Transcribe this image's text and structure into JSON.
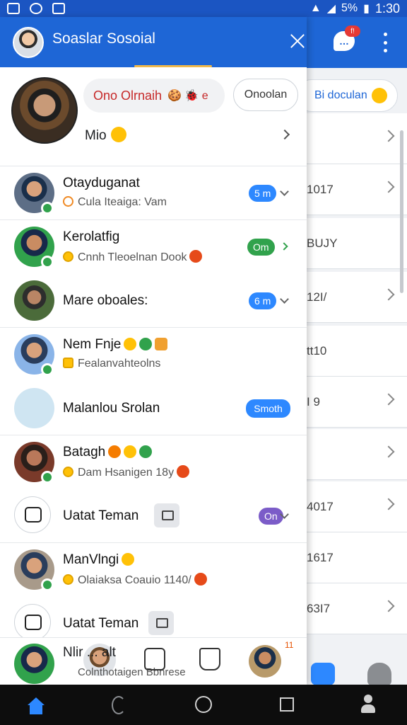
{
  "status_bar": {
    "battery": "5%",
    "time": "1:30"
  },
  "background": {
    "chat_badge": "f!",
    "pill_label": "Bi doculan",
    "rows": [
      "",
      "1017",
      "BUJY",
      "12I/",
      "tt10",
      "I 9",
      "",
      "4017",
      "1617",
      "63I7"
    ]
  },
  "drawer": {
    "title": "Soaslar Sosoial",
    "profile": {
      "status_text": "Ono Olrnaih",
      "status_emoji": "🍪 🐞 e",
      "open_button": "Onoolan",
      "name": "Mio"
    },
    "rows": [
      {
        "name": "Otayduganat",
        "sub": "Cula Iteaiga: Vam",
        "badge": "5 m",
        "badge_color": "#2d88ff",
        "control": "dropdown",
        "online": true,
        "sub_icon": "ring"
      },
      {
        "name": "Kerolatfig",
        "sub": "Cnnh Tleoelnan Dook",
        "badge": "Om",
        "badge_color": "#31a24c",
        "control": "arrow",
        "online": true,
        "sub_icon": "yellow"
      },
      {
        "name": "Mare oboales:",
        "sub": "",
        "badge": "6 m",
        "badge_color": "#2d88ff",
        "control": "dropdown",
        "online": false,
        "sub_icon": ""
      },
      {
        "name": "Nem Fnje",
        "sub": "Fealanvahteolns",
        "badge": "",
        "badge_color": "",
        "control": "",
        "online": true,
        "sub_icon": "square"
      },
      {
        "name": "Malanlou Srolan",
        "sub": "",
        "badge": "Smoth",
        "badge_color": "#2d88ff",
        "control": "",
        "online": false,
        "sub_icon": ""
      },
      {
        "name": "Batagh",
        "sub": "Dam Hsanigen 18y",
        "badge": "",
        "badge_color": "",
        "control": "",
        "online": true,
        "sub_icon": "yellow"
      },
      {
        "name": "Uatat Teman",
        "sub": "",
        "badge": "On",
        "badge_color": "#7b5cc8",
        "control": "dropdown",
        "online": false,
        "sub_icon": ""
      },
      {
        "name": "ManVlngi",
        "sub": "Olaiaksa Coauio 1140/",
        "badge": "",
        "badge_color": "",
        "control": "",
        "online": true,
        "sub_icon": "yellow"
      },
      {
        "name": "Uatat Teman",
        "sub": "",
        "badge": "",
        "badge_color": "",
        "control": "",
        "online": false,
        "sub_icon": ""
      }
    ],
    "bottom": {
      "name": "Nlir ... alt",
      "sub": "Colnthotaigen Bbnrese",
      "count": "11"
    }
  }
}
